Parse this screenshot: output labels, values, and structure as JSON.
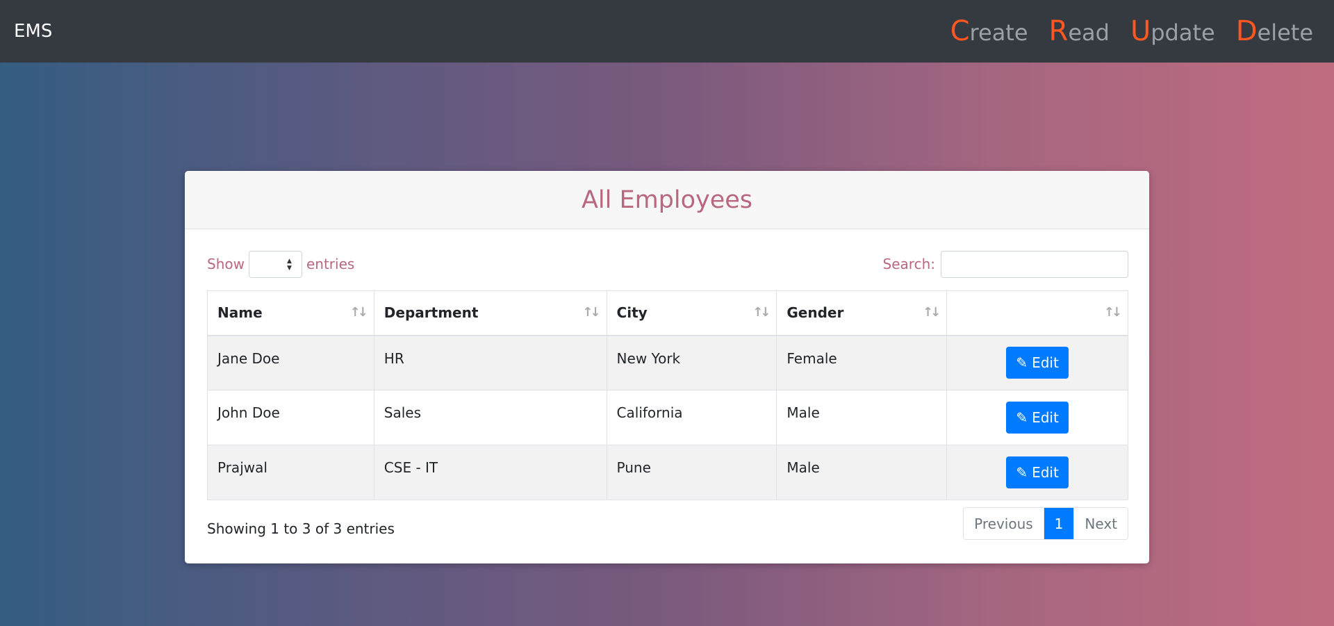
{
  "navbar": {
    "brand": "EMS",
    "links": [
      {
        "first": "C",
        "rest": "reate"
      },
      {
        "first": "R",
        "rest": "ead"
      },
      {
        "first": "U",
        "rest": "pdate"
      },
      {
        "first": "D",
        "rest": "elete"
      }
    ]
  },
  "card": {
    "title": "All Employees",
    "show_label": "Show",
    "entries_label": "entries",
    "entries_value": "",
    "search_label": "Search:",
    "search_value": ""
  },
  "table": {
    "headers": [
      "Name",
      "Department",
      "City",
      "Gender",
      ""
    ],
    "rows": [
      {
        "name": "Jane Doe",
        "department": "HR",
        "city": "New York",
        "gender": "Female",
        "action": "Edit"
      },
      {
        "name": "John Doe",
        "department": "Sales",
        "city": "California",
        "gender": "Male",
        "action": "Edit"
      },
      {
        "name": "Prajwal",
        "department": "CSE - IT",
        "city": "Pune",
        "gender": "Male",
        "action": "Edit"
      }
    ]
  },
  "footer": {
    "info": "Showing 1 to 3 of 3 entries",
    "previous": "Previous",
    "current_page": "1",
    "next": "Next"
  },
  "colors": {
    "navbar_bg": "#343a40",
    "accent_letter": "#ff5722",
    "title_color": "#b9677e",
    "button_primary": "#007bff"
  },
  "icons": {
    "sort": "sort-arrows-icon",
    "edit": "pencil-icon",
    "select_arrows": "select-arrows-icon"
  }
}
